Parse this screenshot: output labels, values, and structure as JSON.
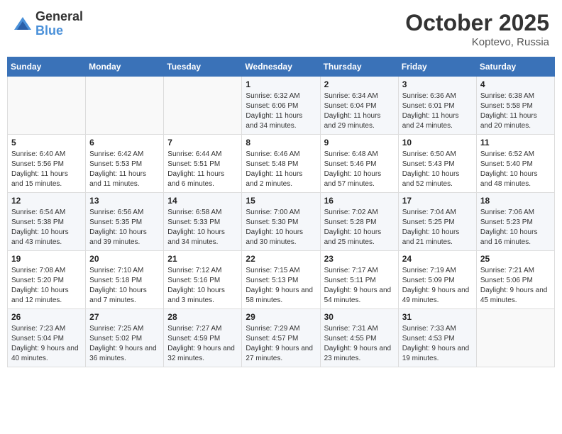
{
  "header": {
    "logo_general": "General",
    "logo_blue": "Blue",
    "month_title": "October 2025",
    "location": "Koptevo, Russia"
  },
  "days_of_week": [
    "Sunday",
    "Monday",
    "Tuesday",
    "Wednesday",
    "Thursday",
    "Friday",
    "Saturday"
  ],
  "weeks": [
    [
      {
        "day": "",
        "info": ""
      },
      {
        "day": "",
        "info": ""
      },
      {
        "day": "",
        "info": ""
      },
      {
        "day": "1",
        "info": "Sunrise: 6:32 AM\nSunset: 6:06 PM\nDaylight: 11 hours\nand 34 minutes."
      },
      {
        "day": "2",
        "info": "Sunrise: 6:34 AM\nSunset: 6:04 PM\nDaylight: 11 hours\nand 29 minutes."
      },
      {
        "day": "3",
        "info": "Sunrise: 6:36 AM\nSunset: 6:01 PM\nDaylight: 11 hours\nand 24 minutes."
      },
      {
        "day": "4",
        "info": "Sunrise: 6:38 AM\nSunset: 5:58 PM\nDaylight: 11 hours\nand 20 minutes."
      }
    ],
    [
      {
        "day": "5",
        "info": "Sunrise: 6:40 AM\nSunset: 5:56 PM\nDaylight: 11 hours\nand 15 minutes."
      },
      {
        "day": "6",
        "info": "Sunrise: 6:42 AM\nSunset: 5:53 PM\nDaylight: 11 hours\nand 11 minutes."
      },
      {
        "day": "7",
        "info": "Sunrise: 6:44 AM\nSunset: 5:51 PM\nDaylight: 11 hours\nand 6 minutes."
      },
      {
        "day": "8",
        "info": "Sunrise: 6:46 AM\nSunset: 5:48 PM\nDaylight: 11 hours\nand 2 minutes."
      },
      {
        "day": "9",
        "info": "Sunrise: 6:48 AM\nSunset: 5:46 PM\nDaylight: 10 hours\nand 57 minutes."
      },
      {
        "day": "10",
        "info": "Sunrise: 6:50 AM\nSunset: 5:43 PM\nDaylight: 10 hours\nand 52 minutes."
      },
      {
        "day": "11",
        "info": "Sunrise: 6:52 AM\nSunset: 5:40 PM\nDaylight: 10 hours\nand 48 minutes."
      }
    ],
    [
      {
        "day": "12",
        "info": "Sunrise: 6:54 AM\nSunset: 5:38 PM\nDaylight: 10 hours\nand 43 minutes."
      },
      {
        "day": "13",
        "info": "Sunrise: 6:56 AM\nSunset: 5:35 PM\nDaylight: 10 hours\nand 39 minutes."
      },
      {
        "day": "14",
        "info": "Sunrise: 6:58 AM\nSunset: 5:33 PM\nDaylight: 10 hours\nand 34 minutes."
      },
      {
        "day": "15",
        "info": "Sunrise: 7:00 AM\nSunset: 5:30 PM\nDaylight: 10 hours\nand 30 minutes."
      },
      {
        "day": "16",
        "info": "Sunrise: 7:02 AM\nSunset: 5:28 PM\nDaylight: 10 hours\nand 25 minutes."
      },
      {
        "day": "17",
        "info": "Sunrise: 7:04 AM\nSunset: 5:25 PM\nDaylight: 10 hours\nand 21 minutes."
      },
      {
        "day": "18",
        "info": "Sunrise: 7:06 AM\nSunset: 5:23 PM\nDaylight: 10 hours\nand 16 minutes."
      }
    ],
    [
      {
        "day": "19",
        "info": "Sunrise: 7:08 AM\nSunset: 5:20 PM\nDaylight: 10 hours\nand 12 minutes."
      },
      {
        "day": "20",
        "info": "Sunrise: 7:10 AM\nSunset: 5:18 PM\nDaylight: 10 hours\nand 7 minutes."
      },
      {
        "day": "21",
        "info": "Sunrise: 7:12 AM\nSunset: 5:16 PM\nDaylight: 10 hours\nand 3 minutes."
      },
      {
        "day": "22",
        "info": "Sunrise: 7:15 AM\nSunset: 5:13 PM\nDaylight: 9 hours\nand 58 minutes."
      },
      {
        "day": "23",
        "info": "Sunrise: 7:17 AM\nSunset: 5:11 PM\nDaylight: 9 hours\nand 54 minutes."
      },
      {
        "day": "24",
        "info": "Sunrise: 7:19 AM\nSunset: 5:09 PM\nDaylight: 9 hours\nand 49 minutes."
      },
      {
        "day": "25",
        "info": "Sunrise: 7:21 AM\nSunset: 5:06 PM\nDaylight: 9 hours\nand 45 minutes."
      }
    ],
    [
      {
        "day": "26",
        "info": "Sunrise: 7:23 AM\nSunset: 5:04 PM\nDaylight: 9 hours\nand 40 minutes."
      },
      {
        "day": "27",
        "info": "Sunrise: 7:25 AM\nSunset: 5:02 PM\nDaylight: 9 hours\nand 36 minutes."
      },
      {
        "day": "28",
        "info": "Sunrise: 7:27 AM\nSunset: 4:59 PM\nDaylight: 9 hours\nand 32 minutes."
      },
      {
        "day": "29",
        "info": "Sunrise: 7:29 AM\nSunset: 4:57 PM\nDaylight: 9 hours\nand 27 minutes."
      },
      {
        "day": "30",
        "info": "Sunrise: 7:31 AM\nSunset: 4:55 PM\nDaylight: 9 hours\nand 23 minutes."
      },
      {
        "day": "31",
        "info": "Sunrise: 7:33 AM\nSunset: 4:53 PM\nDaylight: 9 hours\nand 19 minutes."
      },
      {
        "day": "",
        "info": ""
      }
    ]
  ]
}
